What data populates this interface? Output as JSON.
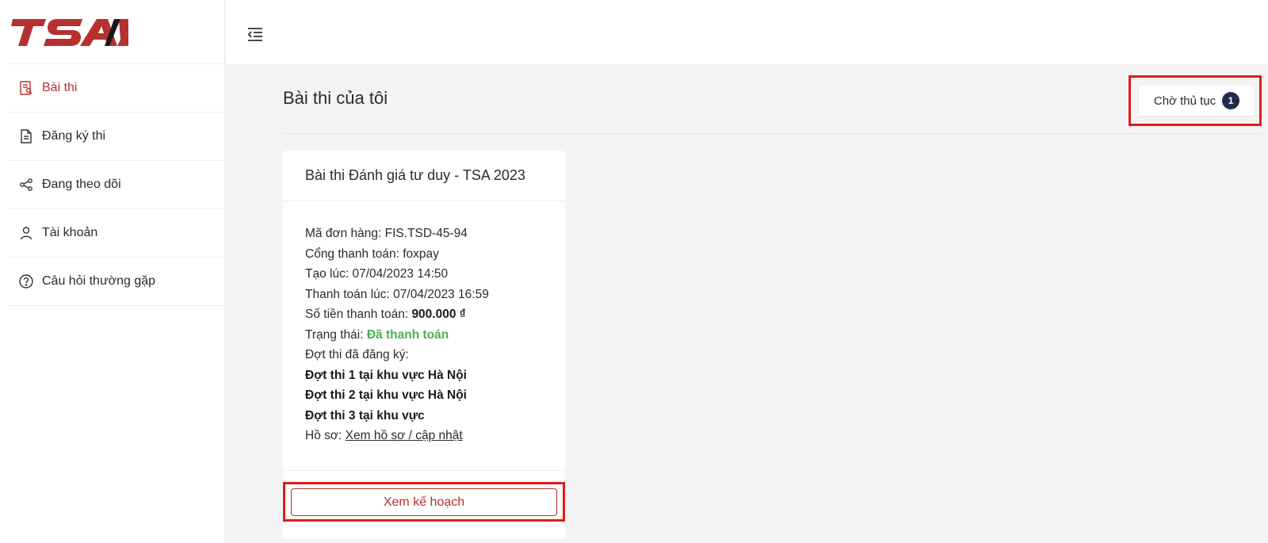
{
  "brand": {
    "logo_text": "TSA",
    "color": "#b5302e"
  },
  "sidebar": {
    "items": [
      {
        "label": "Bài thi",
        "icon": "exam-icon",
        "active": true
      },
      {
        "label": "Đăng ký thi",
        "icon": "document-icon",
        "active": false
      },
      {
        "label": "Đang theo dõi",
        "icon": "share-icon",
        "active": false
      },
      {
        "label": "Tài khoản",
        "icon": "user-icon",
        "active": false
      },
      {
        "label": "Câu hỏi thường gặp",
        "icon": "question-icon",
        "active": false
      }
    ]
  },
  "topbar": {
    "menu_toggle_icon": "menu-collapse-icon"
  },
  "main": {
    "title": "Bài thi của tôi",
    "pending": {
      "label": "Chờ thủ tục",
      "count": "1"
    },
    "card": {
      "title": "Bài thi Đánh giá tư duy - TSA 2023",
      "order_label": "Mã đơn hàng: ",
      "order_value": "FIS.TSD-45-94",
      "gateway_label": "Cổng thanh toán: ",
      "gateway_value": "foxpay",
      "created_label": "Tạo lúc: ",
      "created_value": "07/04/2023 14:50",
      "paid_at_label": "Thanh toán lúc: ",
      "paid_at_value": "07/04/2023 16:59",
      "amount_label": "Số tiền thanh toán: ",
      "amount_value": "900.000 ₫",
      "status_label": "Trạng thái: ",
      "status_value": "Đã thanh toán",
      "status_color": "#4caf50",
      "sessions_label": "Đợt thi đã đăng ký:",
      "sessions": [
        "Đợt thi 1 tại khu vực Hà Nội",
        "Đợt thi 2 tại khu vực Hà Nội",
        "Đợt thi 3 tại khu vực"
      ],
      "profile_label": "Hồ sơ: ",
      "profile_link": "Xem hồ sơ / cập nhật",
      "plan_button": "Xem kế hoạch"
    }
  },
  "highlight_color": "#e01b1b"
}
